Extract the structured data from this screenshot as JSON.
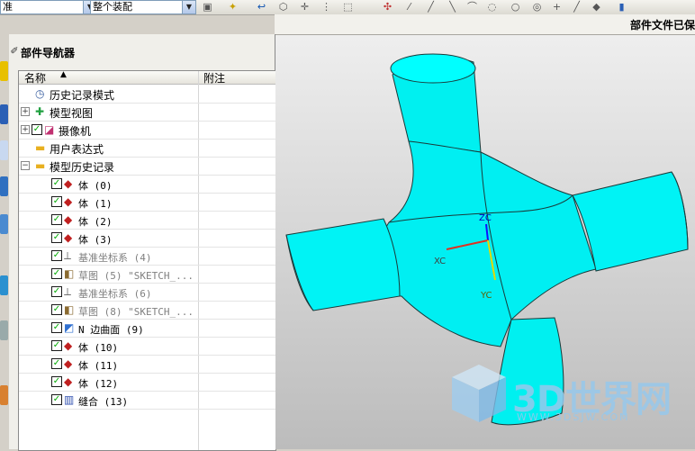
{
  "toolbar": {
    "combo1_value": "准",
    "combo2_value": "整个装配",
    "icons": [
      "layer-icon",
      "view-icon",
      "undo-icon",
      "pan-icon",
      "snap-icon",
      "point-icon",
      "select-box-icon",
      "sketch-icon",
      "line-icon",
      "arc-icon",
      "circle-icon",
      "point-icon",
      "plus-icon",
      "tangent-icon",
      "shade-icon",
      "help-icon"
    ]
  },
  "status": {
    "text": "部件文件已保"
  },
  "navigator": {
    "title": "部件导航器",
    "columns": {
      "name": "名称",
      "note": "附注"
    },
    "rows": [
      {
        "label": "历史记录模式",
        "icon": "clock-icon",
        "level": 1,
        "checked": false,
        "expander": "",
        "gray": false
      },
      {
        "label": "模型视图",
        "icon": "model-view-icon",
        "level": 1,
        "checked": false,
        "expander": "+",
        "gray": false
      },
      {
        "label": "摄像机",
        "icon": "camera-icon",
        "level": 1,
        "checked": true,
        "expander": "+",
        "gray": false
      },
      {
        "label": "用户表达式",
        "icon": "folder-icon",
        "level": 1,
        "checked": false,
        "expander": "",
        "gray": false
      },
      {
        "label": "模型历史记录",
        "icon": "folder-open-icon",
        "level": 1,
        "checked": false,
        "expander": "−",
        "gray": false
      },
      {
        "label": "体 (0)",
        "icon": "body-icon",
        "level": 2,
        "checked": true,
        "expander": "",
        "gray": false
      },
      {
        "label": "体 (1)",
        "icon": "body-icon",
        "level": 2,
        "checked": true,
        "expander": "",
        "gray": false
      },
      {
        "label": "体 (2)",
        "icon": "body-icon",
        "level": 2,
        "checked": true,
        "expander": "",
        "gray": false
      },
      {
        "label": "体 (3)",
        "icon": "body-icon",
        "level": 2,
        "checked": true,
        "expander": "",
        "gray": false
      },
      {
        "label": "基准坐标系 (4)",
        "icon": "datum-csys-icon",
        "level": 2,
        "checked": true,
        "expander": "",
        "gray": true
      },
      {
        "label": "草图 (5) \"SKETCH_...",
        "icon": "sketch-icon",
        "level": 2,
        "checked": true,
        "expander": "",
        "gray": true
      },
      {
        "label": "基准坐标系 (6)",
        "icon": "datum-csys-icon",
        "level": 2,
        "checked": true,
        "expander": "",
        "gray": true
      },
      {
        "label": "草图 (8) \"SKETCH_...",
        "icon": "sketch-icon",
        "level": 2,
        "checked": true,
        "expander": "",
        "gray": true
      },
      {
        "label": "N 边曲面 (9)",
        "icon": "n-sided-surface-icon",
        "level": 2,
        "checked": true,
        "expander": "",
        "gray": false
      },
      {
        "label": "体 (10)",
        "icon": "body-icon",
        "level": 2,
        "checked": true,
        "expander": "",
        "gray": false
      },
      {
        "label": "体 (11)",
        "icon": "body-icon",
        "level": 2,
        "checked": true,
        "expander": "",
        "gray": false
      },
      {
        "label": "体 (12)",
        "icon": "body-icon",
        "level": 2,
        "checked": true,
        "expander": "",
        "gray": false
      },
      {
        "label": "缝合 (13)",
        "icon": "sew-icon",
        "level": 2,
        "checked": true,
        "expander": "",
        "gray": false
      }
    ]
  },
  "viewport": {
    "axes": {
      "x": "XC",
      "y": "YC",
      "z": "ZC"
    },
    "model_color": "#00ffff",
    "watermark": {
      "title": "3D世界网",
      "url": "WWW.3DSJW.COM"
    }
  },
  "colors": {
    "accent": "#2a5fb5",
    "check": "#00a000"
  }
}
